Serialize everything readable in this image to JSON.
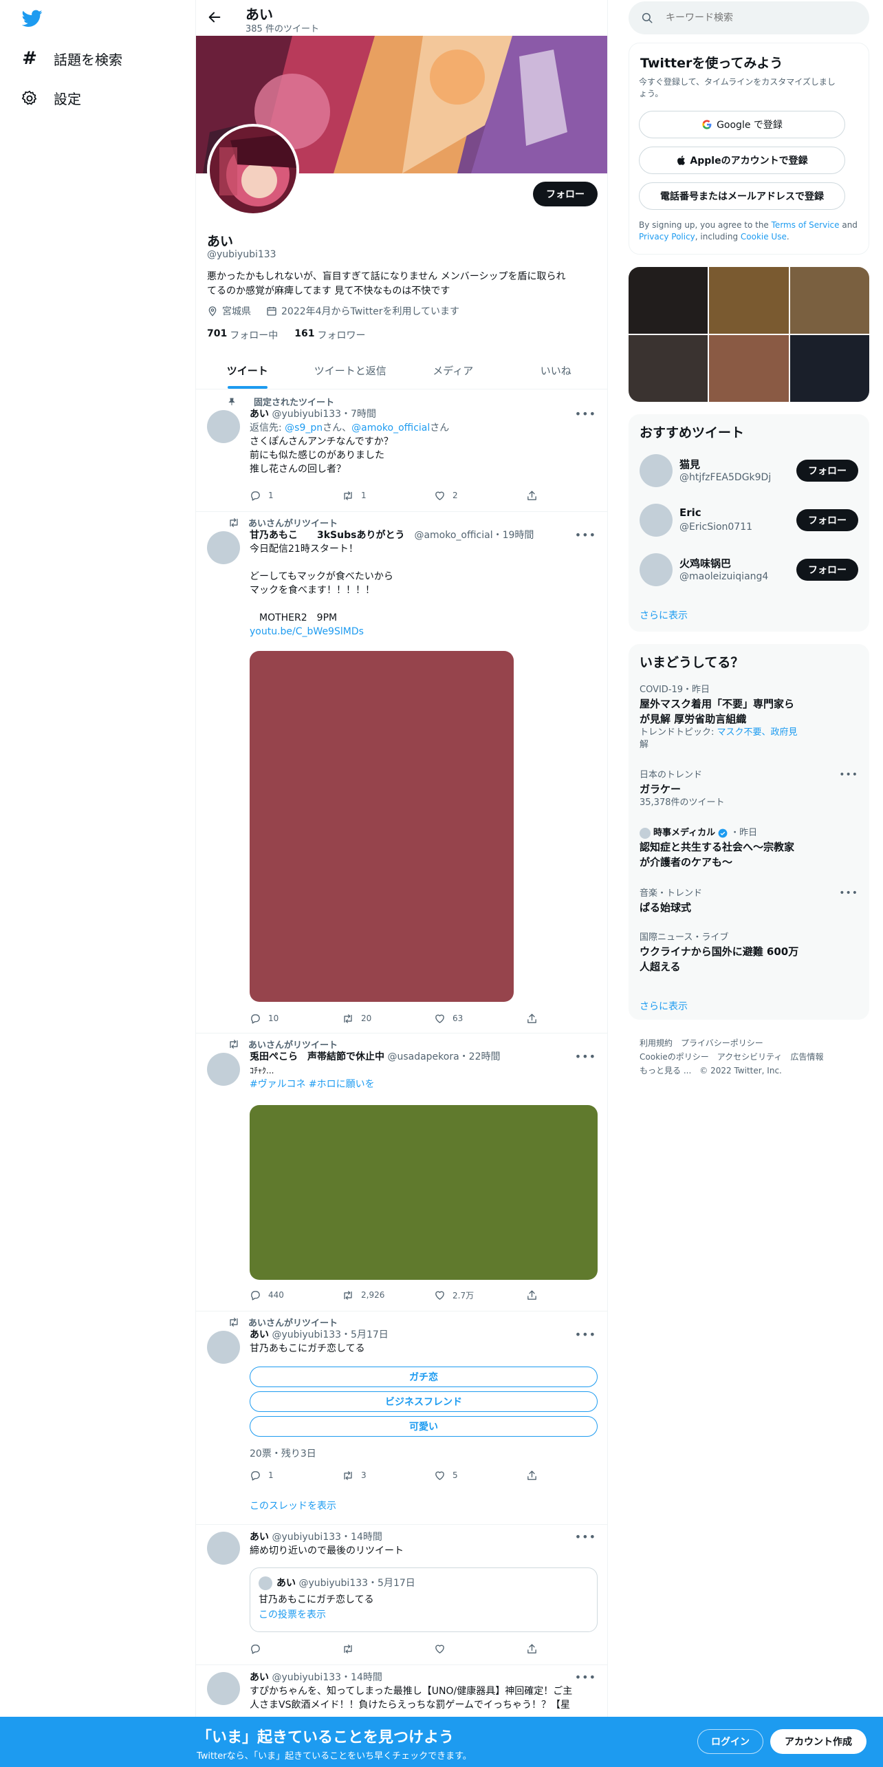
{
  "colors": {
    "accent": "#1d9bf0",
    "banner_bg": "#1d9bf0",
    "text_primary": "#0f1419",
    "text_secondary": "#536471",
    "media_1": "#96444c",
    "media_2": "#607a2d",
    "photo_grid": [
      "#211d1c",
      "#7a5a30",
      "#7a6040",
      "#3a3330",
      "#8a5a44",
      "#1a1f2a"
    ]
  },
  "nav": {
    "logo_icon": "twitter-bird-icon",
    "explore_label": "話題を検索",
    "settings_label": "設定"
  },
  "header": {
    "name": "あい",
    "tweet_count": "385 件のツイート"
  },
  "profile": {
    "follow_label": "フォロー",
    "display_name": "あい",
    "handle": "@yubiyubi133",
    "bio_line1": "悪かったかもしれないが、盲目すぎて話になりません メンバーシップを盾に取られ",
    "bio_line2": "てるのか感覚が麻痺してます 見て不快なものは不快です",
    "location": "宮城県",
    "joined": "2022年4月からTwitterを利用しています",
    "following_count": "701",
    "following_label": "フォロー中",
    "followers_count": "161",
    "followers_label": "フォロワー"
  },
  "tabs": [
    "ツイート",
    "ツイートと返信",
    "メディア",
    "いいね"
  ],
  "tweets": [
    {
      "pinned_label": "固定されたツイート",
      "name": "あい",
      "meta": "@yubiyubi133・7時間",
      "reply_prefix": "返信先: ",
      "reply_to_1": "@s9_pn",
      "reply_mid": "さん、",
      "reply_to_2": "@amoko_official",
      "reply_suffix": "さん",
      "lines": [
        "さくぽんさんアンチなんですか？",
        "前にも似た感じのがありました",
        "推し花さんの回し者？"
      ],
      "replies": "1",
      "retweets": "1",
      "likes": "2"
    },
    {
      "retweeted_label": "あいさんがリツイート",
      "name": "甘乃あもこ　　3kSubsありがとう",
      "meta": "@amoko_official・19時間",
      "lines": [
        "今日配信21時スタート！",
        "",
        "どーしてもマックが食べたいから",
        "マックを食べます！！！！！",
        "",
        "　MOTHER2　9PM"
      ],
      "link": "youtu.be/C_bWe9SlMDs",
      "replies": "10",
      "retweets": "20",
      "likes": "63"
    },
    {
      "retweeted_label": "あいさんがリツイート",
      "name": "兎田ぺこら　声帯結節で休止中",
      "meta": "@usadapekora・22時間",
      "lines": [
        "ｺﾁｬｸ..."
      ],
      "hashtags": "#ヴァルコネ #ホロに願いを",
      "replies": "440",
      "retweets": "2,926",
      "likes": "2.7万"
    },
    {
      "retweeted_label": "あいさんがリツイート",
      "name": "あい",
      "meta": "@yubiyubi133・5月17日",
      "lines": [
        "甘乃あもこにガチ恋してる"
      ],
      "poll_options": [
        "ガチ恋",
        "ビジネスフレンド",
        "可愛い"
      ],
      "poll_status": "20票・残り3日",
      "replies": "1",
      "retweets": "3",
      "likes": "5",
      "thread_link": "このスレッドを表示"
    },
    {
      "name": "あい",
      "meta": "@yubiyubi133・14時間",
      "lines": [
        "締め切り近いので最後のリツイート"
      ],
      "quote": {
        "name": "あい",
        "meta": "@yubiyubi133・5月17日",
        "text": "甘乃あもこにガチ恋してる",
        "link": "この投票を表示"
      }
    },
    {
      "name": "あい",
      "meta": "@yubiyubi133・14時間",
      "lines": [
        "すぴかちゃんを、知ってしまった最推し【UNO/健康器具】神回確定！ご主",
        "人さまVS飲酒メイド！！負けたらえっちな罰ゲームでイっちゃう！？【星"
      ]
    }
  ],
  "search": {
    "placeholder": "キーワード検索"
  },
  "signup": {
    "title": "Twitterを使ってみよう",
    "subtitle_line1": "今すぐ登録して、タイムラインをカスタマイズしまし",
    "subtitle_line2": "ょう。",
    "google": "Google で登録",
    "apple": "Appleのアカウントで登録",
    "phone": "電話番号またはメールアドレスで登録",
    "legal_pre": "By signing up, you agree to the ",
    "terms": "Terms of Service",
    "legal_and": " and",
    "privacy": "Privacy Policy",
    "legal_inc": ", including ",
    "cookie": "Cookie Use",
    "legal_end": "."
  },
  "recommended": {
    "title": "おすすめツイート",
    "users": [
      {
        "name": "猫見",
        "handle": "@htjfzFEA5DGk9Dj"
      },
      {
        "name": "Eric",
        "handle": "@EricSion0711"
      },
      {
        "name": "火鸡味锅巴",
        "handle": "@maoleizuiqiang4"
      }
    ],
    "follow_label": "フォロー",
    "show_more": "さらに表示"
  },
  "trends": {
    "title": "いまどうしてる？",
    "items": [
      {
        "context": "COVID-19・昨日",
        "title_l1": "屋外マスク着用「不要」専門家ら",
        "title_l2": "が見解 厚労省助言組織",
        "topic_label": "トレンドトピック: ",
        "topic_links_l1": "マスク不要、政府見",
        "topic_links_l2": "解"
      },
      {
        "context": "日本のトレンド",
        "title_l1": "ガラケー",
        "count": "35,378件のツイート"
      },
      {
        "source": "時事メディカル",
        "context": "・昨日",
        "title_l1": "認知症と共生する社会へ～宗教家",
        "title_l2": "が介護者のケアも～"
      },
      {
        "context": "音楽・トレンド",
        "title_l1": "ぱる始球式"
      },
      {
        "context": "国際ニュース・ライブ",
        "title_l1": "ウクライナから国外に避難 600万",
        "title_l2": "人超える"
      }
    ],
    "show_more": "さらに表示"
  },
  "footer": {
    "terms": "利用規約",
    "privacy": "プライバシーポリシー",
    "cookie": "Cookieのポリシー",
    "accessibility": "アクセシビリティ",
    "ads": "広告情報",
    "more": "もっと見る ...",
    "copyright": "© 2022 Twitter, Inc."
  },
  "banner": {
    "title": "「いま」起きていることを見つけよう",
    "subtitle": "Twitterなら、「いま」起きていることをいち早くチェックできます。",
    "login": "ログイン",
    "signup": "アカウント作成"
  }
}
